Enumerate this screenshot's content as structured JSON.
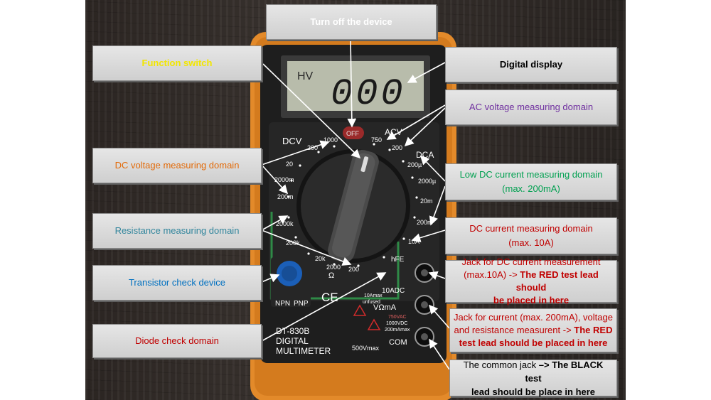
{
  "colors": {
    "housing_orange": "#e38a2a",
    "bezel_black": "#1e1e1e",
    "lcd": "#b8bcab",
    "callout_bg": "#d9d9d9",
    "yellow_label": "#f2e600",
    "orange_label": "#e26b0a",
    "purple_label": "#7030a0",
    "green_label": "#00a050",
    "blue_label": "#31859c",
    "dark_blue_label": "#0070c0",
    "red_label": "#c00000",
    "black_label": "#000000"
  },
  "callouts": {
    "turn_off": "Turn off the device",
    "function_switch": "Function switch",
    "digital_display": "Digital display",
    "ac_voltage": "AC voltage measuring domain",
    "dc_voltage": "DC voltage measuring domain",
    "low_dc_current_1": "Low DC current measuring domain",
    "low_dc_current_2": "(max. 200mA)",
    "resistance": "Resistance measuring domain",
    "dc_current_1": "DC current measuring domain",
    "dc_current_2": "(max. 10A)",
    "transistor": "Transistor check device",
    "jack_10a_1": "Jack for DC current measurement",
    "jack_10a_2": "(max.10A) -> ",
    "jack_10a_3": "The RED test lead should",
    "jack_10a_4": "be placed in here",
    "diode": "Diode check domain",
    "jack_vma_1": "Jack for current (max. 200mA), voltage",
    "jack_vma_2": "and resistance measurent -> ",
    "jack_vma_3": "The RED",
    "jack_vma_4": "test lead should be placed in here",
    "com_1": "The common jack ",
    "com_2": "–> The BLACK test",
    "com_3": "lead should be place in here"
  },
  "meter": {
    "lcd_hv": "HV",
    "lcd_digits": "000",
    "off": "OFF",
    "acv": "ACV",
    "acv_750": "750",
    "acv_200": "200",
    "dcv": "DCV",
    "dcv_1000": "1000",
    "dcv_200": "200",
    "dcv_20": "20",
    "dcv_2000m": "2000m",
    "dcv_200m": "200m",
    "dca": "DCA",
    "dca_200u": "200µ",
    "dca_2000u": "2000µ",
    "dca_20m": "20m",
    "dca_200m": "200m",
    "dca_10a": "10A",
    "ohm_200": "200",
    "ohm_2000": "2000",
    "ohm_20k": "20k",
    "ohm_200k": "200k",
    "ohm_2000k": "2000k",
    "ohm_unit": "Ω",
    "ohm_2000_b": "2000",
    "hfe": "hFE",
    "npn": "NPN",
    "pnp": "PNP",
    "ce": "CE",
    "model": "DT-830B",
    "digital": "DIGITAL",
    "multimeter": "MULTIMETER",
    "jack_10adc": "10ADC",
    "jack_10a_max": "10Amax",
    "jack_unfused": "unfused",
    "jack_vma": "VΩmA",
    "v750": "750VAC",
    "v1000": "1000VDC",
    "ma200": "200mAmax",
    "com": "COM",
    "v500": "500Vmax"
  }
}
